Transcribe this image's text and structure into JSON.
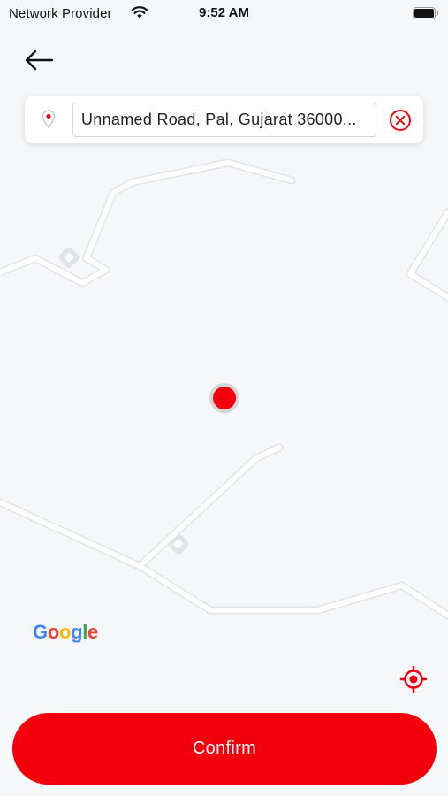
{
  "status_bar": {
    "carrier": "Network Provider",
    "time": "9:52 AM"
  },
  "search": {
    "address": "Unnamed Road, Pal, Gujarat 36000..."
  },
  "map": {
    "attribution": [
      "G",
      "o",
      "o",
      "g",
      "l",
      "e"
    ],
    "attribution_colors": [
      "#4285F4",
      "#EA4335",
      "#FBBC05",
      "#4285F4",
      "#34A853",
      "#EA4335"
    ]
  },
  "actions": {
    "confirm_label": "Confirm"
  },
  "colors": {
    "accent": "#f2000c",
    "map_background": "#f6f7f9",
    "road": "#ffffff"
  },
  "icons": {
    "back": "arrow-left-icon",
    "pin": "map-pin-icon",
    "clear": "close-circle-icon",
    "my_location": "crosshair-icon"
  }
}
